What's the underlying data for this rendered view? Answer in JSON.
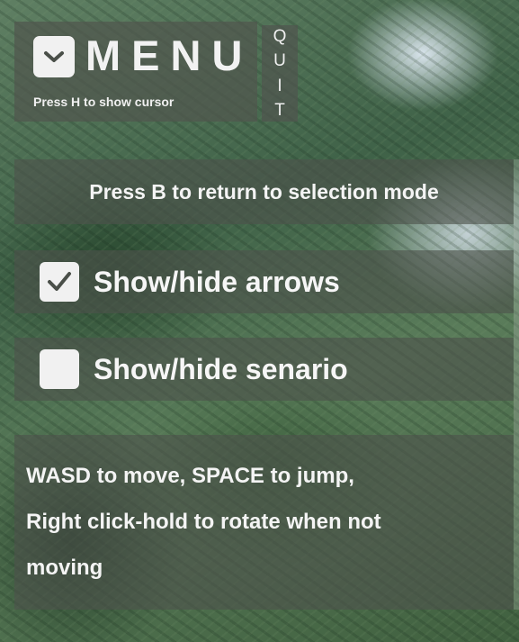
{
  "menu": {
    "title": "MENU",
    "hint": "Press H to show cursor",
    "quit_letters": [
      "Q",
      "U",
      "I",
      "T"
    ]
  },
  "return_hint": "Press B to return to selection mode",
  "toggles": [
    {
      "label": "Show/hide arrows",
      "checked": true
    },
    {
      "label": "Show/hide senario",
      "checked": false
    }
  ],
  "help": {
    "lines": [
      "WASD to move, SPACE to jump,",
      "Right click-hold to rotate when not",
      "moving"
    ]
  },
  "colors": {
    "panel": "#4e524c",
    "text": "#f4f4f4",
    "checkbox": "#f1f1f1",
    "check_mark": "#4a4f49"
  },
  "icons": {
    "menu_toggle": "chevron-down-icon",
    "checked": "checkmark-icon"
  }
}
